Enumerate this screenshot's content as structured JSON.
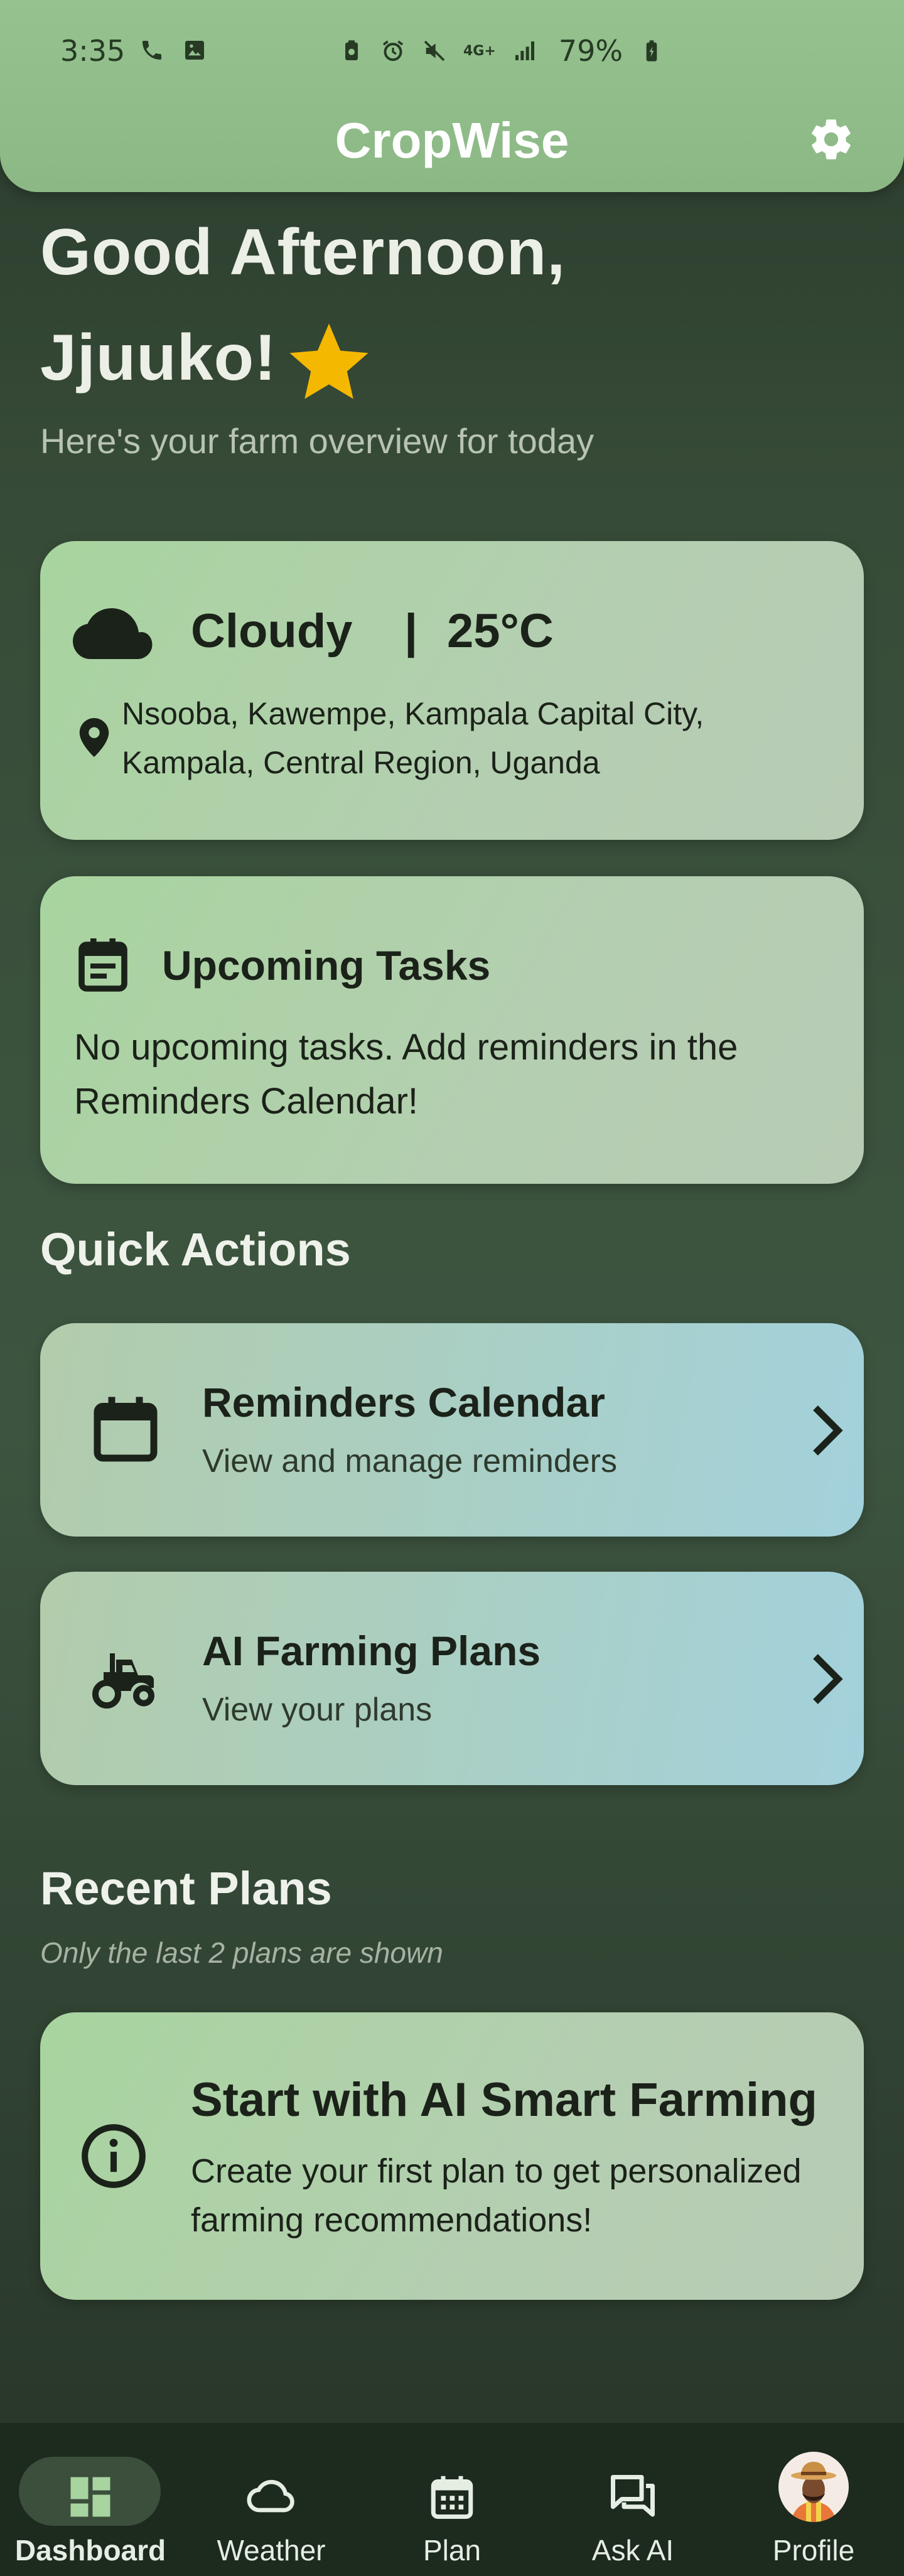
{
  "status_bar": {
    "time": "3:35",
    "network": "4G+",
    "battery": "79%"
  },
  "app_bar": {
    "title": "CropWise",
    "settings_icon": "gear-icon"
  },
  "greeting": {
    "line1": "Good Afternoon,",
    "line2": "Jjuuko!",
    "star_icon": "star-icon",
    "subtitle": "Here's your farm overview for today"
  },
  "weather": {
    "icon": "cloud-icon",
    "condition": "Cloudy",
    "separator": "|",
    "temperature": "25°C",
    "location": "Nsooba, Kawempe, Kampala Capital City, Kampala, Central Region, Uganda"
  },
  "tasks": {
    "icon": "event-note-icon",
    "title": "Upcoming Tasks",
    "body": "No upcoming tasks. Add reminders in the Reminders Calendar!"
  },
  "quick_actions": {
    "title": "Quick Actions",
    "items": [
      {
        "title": "Reminders Calendar",
        "subtitle": "View and manage reminders",
        "icon": "calendar-icon"
      },
      {
        "title": "AI Farming Plans",
        "subtitle": "View your plans",
        "icon": "tractor-icon"
      }
    ]
  },
  "recent_plans": {
    "title": "Recent Plans",
    "note": "Only the last 2 plans are shown",
    "empty_card": {
      "icon": "info-icon",
      "title": "Start with AI Smart Farming",
      "body": "Create your first plan to get personalized farming recommendations!"
    }
  },
  "bottom_nav": [
    {
      "label": "Dashboard",
      "icon": "dashboard-icon",
      "active": true
    },
    {
      "label": "Weather",
      "icon": "cloud-outline-icon",
      "active": false
    },
    {
      "label": "Plan",
      "icon": "calendar-grid-icon",
      "active": false
    },
    {
      "label": "Ask AI",
      "icon": "chat-icon",
      "active": false
    },
    {
      "label": "Profile",
      "icon": "avatar",
      "active": false
    }
  ],
  "colors": {
    "app_bar": "#95c28f",
    "background": "#374c38",
    "card_green": "#a8d49f",
    "card_teal": "#a3d1dc",
    "star": "#f5b800",
    "nav_background": "#1d2a1e"
  }
}
